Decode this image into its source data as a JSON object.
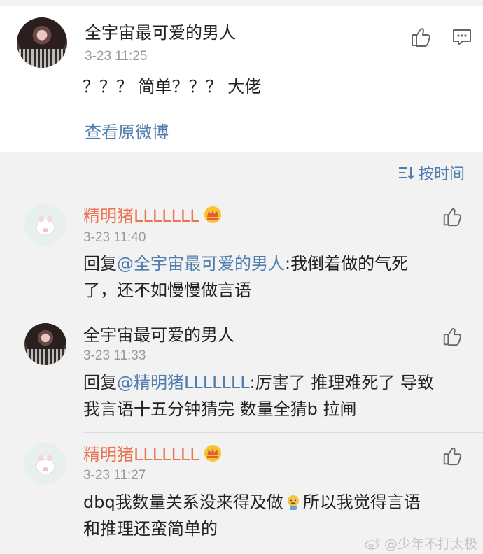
{
  "post": {
    "author": "全宇宙最可爱的男人",
    "time": "3-23 11:25",
    "content": "？？？ 简单？？？ 大佬",
    "view_original": "查看原微博"
  },
  "sort": {
    "label": "按时间"
  },
  "comments": [
    {
      "author": "精明猪LLLLLLL",
      "time": "3-23 11:40",
      "reply_prefix": "回复",
      "mention": "@全宇宙最可爱的男人",
      "line1_rest": ":我倒着做的气死",
      "line2": "了，还不如慢慢做言语"
    },
    {
      "author": "全宇宙最可爱的男人",
      "time": "3-23 11:33",
      "reply_prefix": "回复",
      "mention": "@精明猪LLLLLLL",
      "line1_rest": ":厉害了 推理难死了 导致",
      "line2": "我言语十五分钟猜完 数量全猜b 拉闸"
    },
    {
      "author": "精明猪LLLLLLL",
      "time": "3-23 11:27",
      "line1_a": "dbq我数量关系没来得及做",
      "line1_b": "所以我觉得言语",
      "line2": "和推理还蛮简单的"
    }
  ],
  "watermark": "@少年不打太极",
  "colors": {
    "link": "#507daf",
    "username_orange": "#eb7350",
    "time_gray": "#999999",
    "background": "#f2f2f2"
  }
}
